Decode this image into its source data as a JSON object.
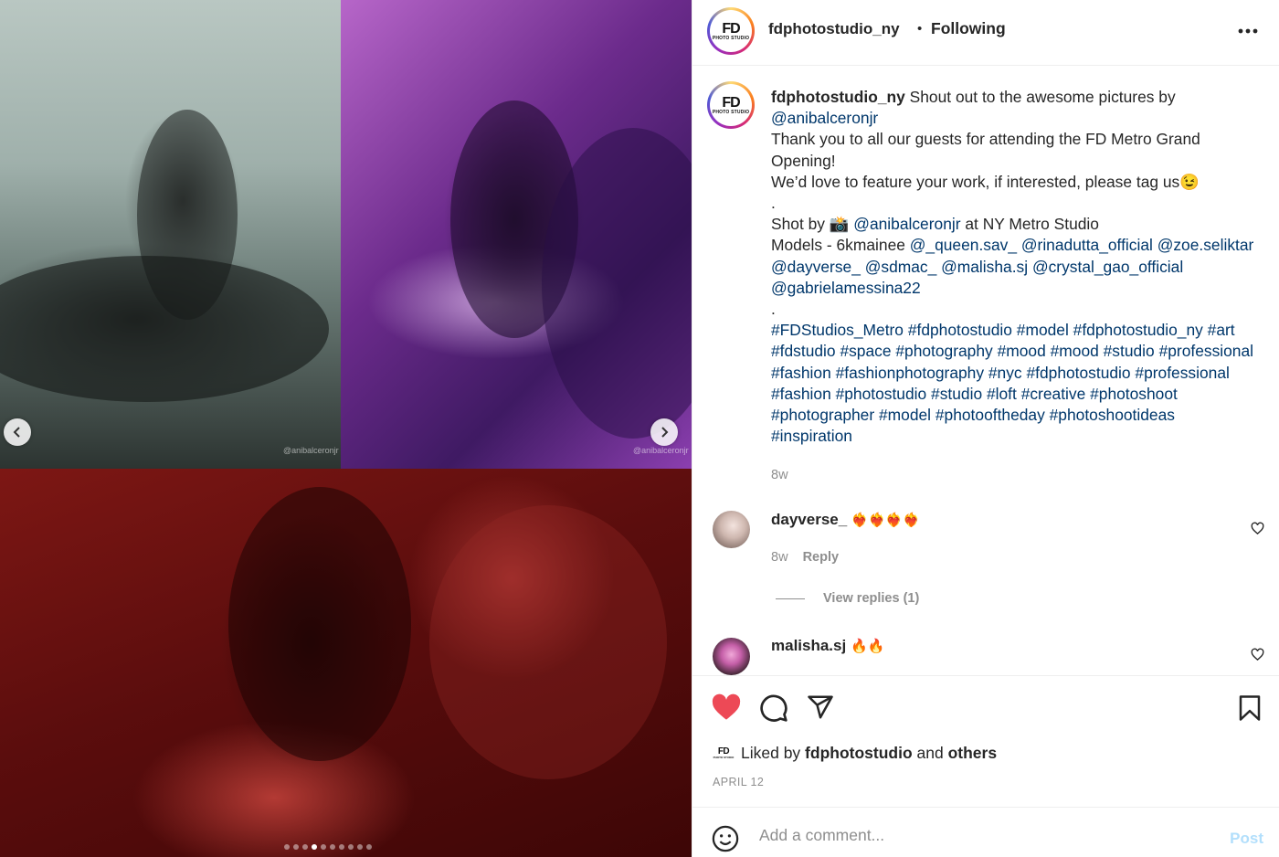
{
  "media": {
    "watermarks": [
      "@anibalceronjr",
      "@anibalceronjr"
    ],
    "carousel": {
      "total_slides": 10,
      "active_index": 3
    },
    "prev_icon": "chevron-left-icon",
    "next_icon": "chevron-right-icon"
  },
  "header": {
    "logo_text": "FD",
    "logo_sub": "PHOTO STUDIO",
    "username": "fdphotostudio_ny",
    "separator": "•",
    "follow_status": "Following",
    "more_icon": "more-options-icon"
  },
  "caption": {
    "username": "fdphotostudio_ny",
    "text_1": " Shout out to the awesome pictures by ",
    "mention_1": "@anibalceronjr",
    "line_2": "Thank you to all our guests for attending the FD Metro Grand Opening!",
    "line_3": "We’d love to feature your work, if interested, please tag us😉",
    "dot_1": ".",
    "shot_by_prefix": "Shot by 📸 ",
    "shot_by_mention": "@anibalceronjr",
    "shot_by_suffix": " at NY Metro Studio",
    "models_prefix": "Models - 6kmainee ",
    "model_mentions": [
      "@_queen.sav_",
      "@rinadutta_official",
      "@zoe.seliktar",
      "@dayverse_",
      "@sdmac_",
      "@malisha.sj",
      "@crystal_gao_official",
      "@gabrielamessina22"
    ],
    "dot_2": ".",
    "hashtags": [
      "#FDStudios_Metro",
      "#fdphotostudio",
      "#model",
      "#fdphotostudio_ny",
      "#art",
      "#fdstudio",
      "#space",
      "#photography",
      "#mood",
      "#mood",
      "#studio",
      "#professional",
      "#fashion",
      "#fashionphotography",
      "#nyc",
      "#fdphotostudio",
      "#professional",
      "#fashion",
      "#photostudio",
      "#studio",
      "#loft",
      "#creative",
      "#photoshoot",
      "#photographer",
      "#model",
      "#photooftheday",
      "#photoshootideas",
      "#inspiration"
    ],
    "time": "8w"
  },
  "comments": [
    {
      "username": "dayverse_",
      "text": "❤️‍🔥❤️‍🔥❤️‍🔥❤️‍🔥",
      "time": "8w",
      "reply_label": "Reply",
      "view_replies": "View replies (1)"
    },
    {
      "username": "malisha.sj",
      "text": "🔥🔥"
    }
  ],
  "actions": {
    "like_icon": "heart-filled-icon",
    "comment_icon": "comment-icon",
    "share_icon": "share-icon",
    "save_icon": "bookmark-icon",
    "liked_by_prefix": "Liked by ",
    "liked_by_user": "fdphotostudio",
    "liked_by_and": " and ",
    "liked_by_others": "others",
    "date": "APRIL 12",
    "like_color": "#ed4956"
  },
  "add_comment": {
    "emoji_icon": "smiley-icon",
    "placeholder": "Add a comment...",
    "post_label": "Post"
  }
}
